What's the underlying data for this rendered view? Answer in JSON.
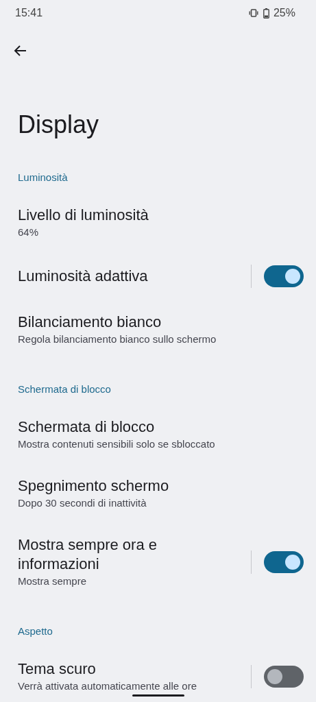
{
  "status_bar": {
    "time": "15:41",
    "battery": "25%"
  },
  "title": "Display",
  "sections": [
    {
      "header": "Luminosità",
      "items": [
        {
          "kind": "text",
          "title": "Livello di luminosità",
          "summary": "64%"
        },
        {
          "kind": "switch",
          "title": "Luminosità adattiva",
          "on": true
        },
        {
          "kind": "text",
          "title": "Bilanciamento bianco",
          "summary": "Regola bilanciamento bianco sullo schermo"
        }
      ]
    },
    {
      "header": "Schermata di blocco",
      "items": [
        {
          "kind": "text",
          "title": "Schermata di blocco",
          "summary": "Mostra contenuti sensibili solo se sbloccato"
        },
        {
          "kind": "text",
          "title": "Spegnimento schermo",
          "summary": "Dopo 30 secondi di inattività"
        },
        {
          "kind": "switch",
          "title": "Mostra sempre ora e informazioni",
          "summary": "Mostra sempre",
          "on": true
        }
      ]
    },
    {
      "header": "Aspetto",
      "items": [
        {
          "kind": "switch",
          "title": "Tema scuro",
          "summary": "Verrà attivata automaticamente alle ore",
          "on": false
        }
      ]
    }
  ]
}
